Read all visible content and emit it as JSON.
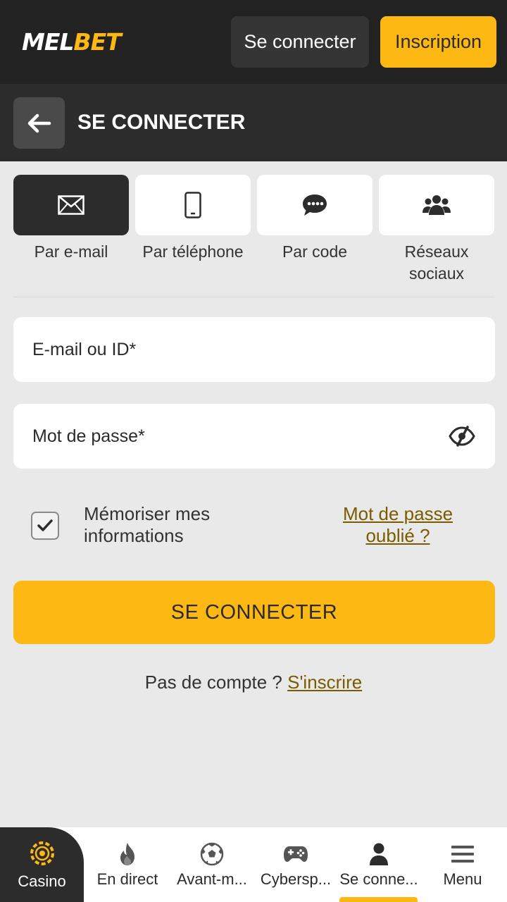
{
  "header": {
    "logo_part1": "MEL",
    "logo_part2": "BET",
    "login_label": "Se connecter",
    "register_label": "Inscription"
  },
  "subheader": {
    "title": "SE CONNECTER",
    "back_icon": "arrow-left-icon"
  },
  "login_methods": [
    {
      "label": "Par e-mail",
      "icon": "envelope-icon",
      "active": true
    },
    {
      "label": "Par téléphone",
      "icon": "smartphone-icon",
      "active": false
    },
    {
      "label": "Par code",
      "icon": "chat-bubble-icon",
      "active": false
    },
    {
      "label": "Réseaux sociaux",
      "icon": "users-icon",
      "active": false
    }
  ],
  "form": {
    "email_placeholder": "E-mail ou ID*",
    "email_value": "",
    "password_placeholder": "Mot de passe*",
    "password_value": "",
    "remember_label": "Mémoriser mes informations",
    "remember_checked": true,
    "forgot_label": "Mot de passe oublié ?",
    "submit_label": "SE CONNECTER"
  },
  "signup": {
    "prompt": "Pas de compte ? ",
    "link": "S'inscrire"
  },
  "bottom_nav": [
    {
      "label": "Casino",
      "icon": "casino-chip-icon"
    },
    {
      "label": "En direct",
      "icon": "flame-icon"
    },
    {
      "label": "Avant-m...",
      "icon": "soccer-ball-icon"
    },
    {
      "label": "Cybersp...",
      "icon": "gamepad-icon"
    },
    {
      "label": "Se conne...",
      "icon": "user-icon",
      "active": true
    },
    {
      "label": "Menu",
      "icon": "hamburger-menu-icon"
    }
  ],
  "colors": {
    "accent": "#fdb813",
    "dark": "#222222",
    "link": "#7a5c00"
  }
}
